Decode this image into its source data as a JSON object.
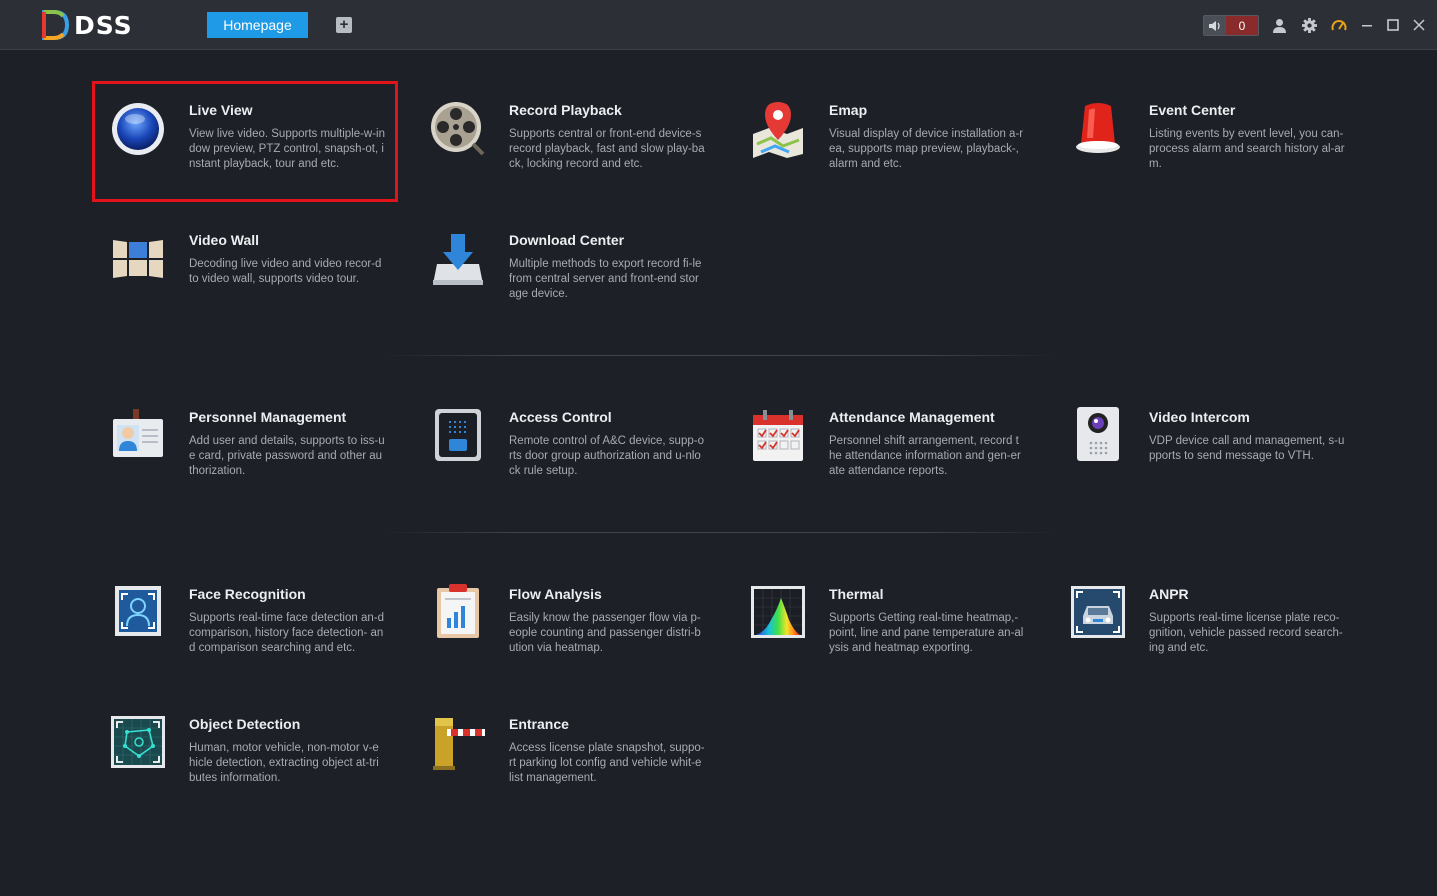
{
  "app": {
    "logo_text": "DSS",
    "tab_home_label": "Homepage",
    "tab_add_label": "+",
    "alarm_count": "0"
  },
  "modules": [
    {
      "name": "Live View",
      "desc": "View live video. Supports multiple-w-indow preview, PTZ control, snapsh-ot, instant playback, tour and etc.",
      "icon": "live-view-icon"
    },
    {
      "name": "Record Playback",
      "desc": "Supports central or front-end device-s record playback, fast and slow play-back, locking record and etc.",
      "icon": "film-reel-icon"
    },
    {
      "name": "Emap",
      "desc": "Visual display of device installation a-rea, supports map preview, playback-, alarm and etc.",
      "icon": "map-pin-icon"
    },
    {
      "name": "Event Center",
      "desc": "Listing events by event level, you can- process alarm and search history al-arm.",
      "icon": "alarm-light-icon"
    },
    {
      "name": "Video Wall",
      "desc": "Decoding live video and video recor-d to video wall, supports video tour.",
      "icon": "video-wall-icon"
    },
    {
      "name": "Download Center",
      "desc": "Multiple methods to export record fi-le from central server and front-end storage device.",
      "icon": "download-icon"
    },
    {
      "name": "Personnel Management",
      "desc": "Add user and details, supports to iss-ue card, private password and other authorization.",
      "icon": "id-badge-icon"
    },
    {
      "name": "Access Control",
      "desc": "Remote control of A&C device, supp-orts door group authorization and u-nlock rule setup.",
      "icon": "access-panel-icon"
    },
    {
      "name": "Attendance Management",
      "desc": "Personnel shift arrangement, record the attendance information and gen-erate attendance reports.",
      "icon": "calendar-icon"
    },
    {
      "name": "Video Intercom",
      "desc": "VDP device call and management, s-upports to send message to VTH.",
      "icon": "intercom-icon"
    },
    {
      "name": "Face Recognition",
      "desc": "Supports real-time face detection an-d comparison, history face detection- and comparison searching and etc.",
      "icon": "face-scan-icon"
    },
    {
      "name": "Flow Analysis",
      "desc": "Easily know the passenger flow via p-eople counting and passenger distri-bution via heatmap.",
      "icon": "clipboard-chart-icon"
    },
    {
      "name": "Thermal",
      "desc": "Supports Getting real-time heatmap,- point, line and pane temperature an-alysis and heatmap exporting.",
      "icon": "thermal-chart-icon"
    },
    {
      "name": "ANPR",
      "desc": "Supports real-time license plate reco-gnition, vehicle passed record search-ing and etc.",
      "icon": "car-scan-icon"
    },
    {
      "name": "Object Detection",
      "desc": "Human, motor vehicle, non-motor v-ehicle detection, extracting object at-tributes information.",
      "icon": "object-grid-icon"
    },
    {
      "name": "Entrance",
      "desc": "Access license plate snapshot, suppo-rt parking lot config and vehicle whit-e list management.",
      "icon": "barrier-gate-icon"
    }
  ],
  "selected_module": "Live View"
}
